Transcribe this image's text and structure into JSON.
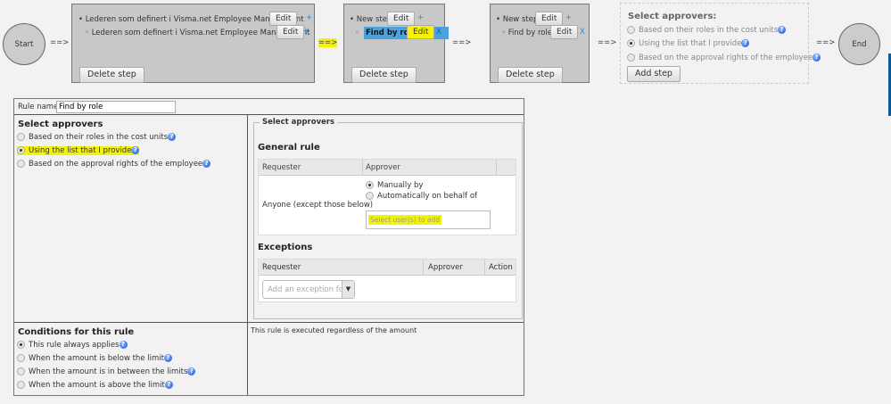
{
  "flow": {
    "start": "Start",
    "end": "End",
    "arrow": "==>",
    "step1": {
      "item1": "Lederen som definert i Visma.net Employee Management",
      "item2": "Lederen som definert i Visma.net Employee Management",
      "edit": "Edit",
      "add": "+",
      "remove": "X",
      "delete": "Delete step"
    },
    "step2": {
      "item1": "New step",
      "item2": "Find by role",
      "edit": "Edit",
      "add": "+",
      "remove": "X",
      "delete": "Delete step"
    },
    "step3": {
      "item1": "New step",
      "item2": "Find by role",
      "edit": "Edit",
      "add": "+",
      "remove": "X",
      "delete": "Delete step"
    },
    "new_step": {
      "title": "Select approvers:",
      "options": [
        "Based on their roles in the cost units",
        "Using the list that I provide",
        "Based on the approval rights of the employee"
      ],
      "add": "Add step"
    }
  },
  "rule": {
    "name_label": "Rule name:",
    "name_value": "Find by role",
    "select_title": "Select approvers",
    "select_options": [
      "Based on their roles in the cost units",
      "Using the list that I provide",
      "Based on the approval rights of the employee"
    ],
    "fieldset_legend": "Select approvers",
    "general_title": "General rule",
    "general_headers": [
      "Requester",
      "Approver"
    ],
    "general_requester": "Anyone (except those below)",
    "approver_options": [
      "Manually by",
      "Automatically on behalf of"
    ],
    "user_placeholder": "Select user(s) to add",
    "exceptions_title": "Exceptions",
    "exception_headers": [
      "Requester",
      "Approver",
      "Action"
    ],
    "exception_placeholder": "Add an exception for",
    "conditions_title": "Conditions for this rule",
    "conditions": [
      "This rule always applies",
      "When the amount is below the limit",
      "When the amount is in between the limits",
      "When the amount is above the limit"
    ],
    "condition_text": "This rule is executed regardless of the amount"
  }
}
